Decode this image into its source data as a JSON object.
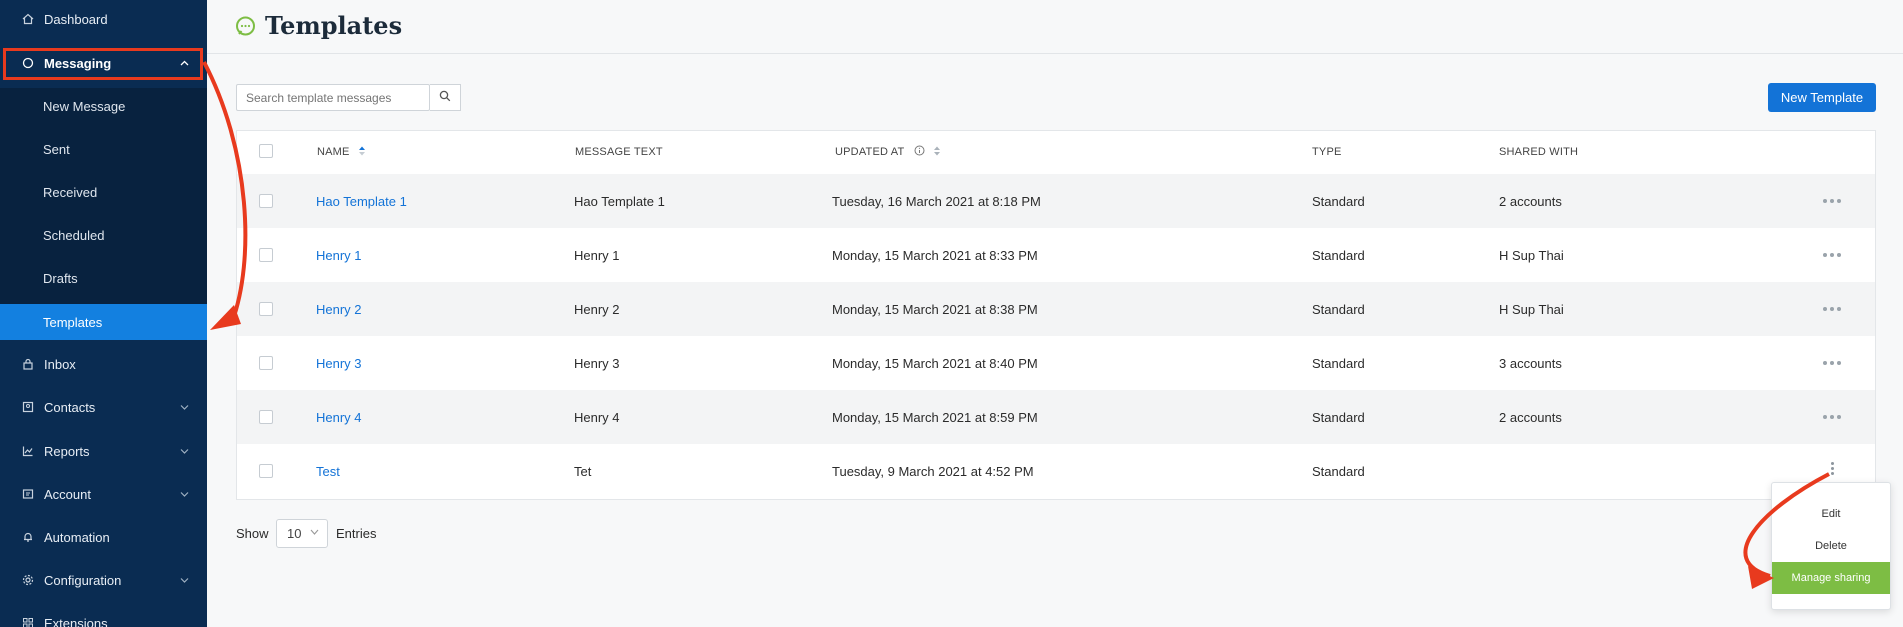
{
  "sidebar": {
    "items": [
      {
        "label": "Dashboard",
        "icon": "home-icon"
      },
      {
        "label": "Messaging",
        "icon": "circle-icon"
      },
      {
        "label": "New Message"
      },
      {
        "label": "Sent"
      },
      {
        "label": "Received"
      },
      {
        "label": "Scheduled"
      },
      {
        "label": "Drafts"
      },
      {
        "label": "Templates"
      },
      {
        "label": "Inbox",
        "icon": "lock-icon"
      },
      {
        "label": "Contacts",
        "icon": "address-book-icon"
      },
      {
        "label": "Reports",
        "icon": "chart-icon"
      },
      {
        "label": "Account",
        "icon": "account-card-icon"
      },
      {
        "label": "Automation",
        "icon": "bell-icon"
      },
      {
        "label": "Configuration",
        "icon": "gear-icon"
      },
      {
        "label": "Extensions",
        "icon": "grid-icon"
      }
    ]
  },
  "header": {
    "title": "Templates"
  },
  "search": {
    "placeholder": "Search template messages"
  },
  "toolbar": {
    "new_template": "New Template"
  },
  "table": {
    "columns": [
      "NAME",
      "MESSAGE TEXT",
      "UPDATED AT",
      "TYPE",
      "SHARED WITH"
    ],
    "rows": [
      {
        "name": "Hao Template 1",
        "text": "Hao Template 1",
        "updated": "Tuesday, 16 March 2021 at 8:18 PM",
        "type": "Standard",
        "shared": "2 accounts"
      },
      {
        "name": "Henry 1",
        "text": "Henry 1",
        "updated": "Monday, 15 March 2021 at 8:33 PM",
        "type": "Standard",
        "shared": "H Sup Thai"
      },
      {
        "name": "Henry 2",
        "text": "Henry 2",
        "updated": "Monday, 15 March 2021 at 8:38 PM",
        "type": "Standard",
        "shared": "H Sup Thai"
      },
      {
        "name": "Henry 3",
        "text": "Henry 3",
        "updated": "Monday, 15 March 2021 at 8:40 PM",
        "type": "Standard",
        "shared": "3 accounts"
      },
      {
        "name": "Henry 4",
        "text": "Henry 4",
        "updated": "Monday, 15 March 2021 at 8:59 PM",
        "type": "Standard",
        "shared": "2 accounts"
      },
      {
        "name": "Test",
        "text": "Tet",
        "updated": "Tuesday, 9 March 2021 at 4:52 PM",
        "type": "Standard",
        "shared": ""
      }
    ]
  },
  "footer": {
    "show": "Show",
    "page_size": "10",
    "entries": "Entries"
  },
  "menu": {
    "items": [
      "Edit",
      "Delete",
      "Manage sharing"
    ]
  },
  "colors": {
    "sidebar": "#0a2c52",
    "accent": "#1373d7",
    "highlight": "#e83a1e",
    "menu_active": "#7dbd44"
  }
}
